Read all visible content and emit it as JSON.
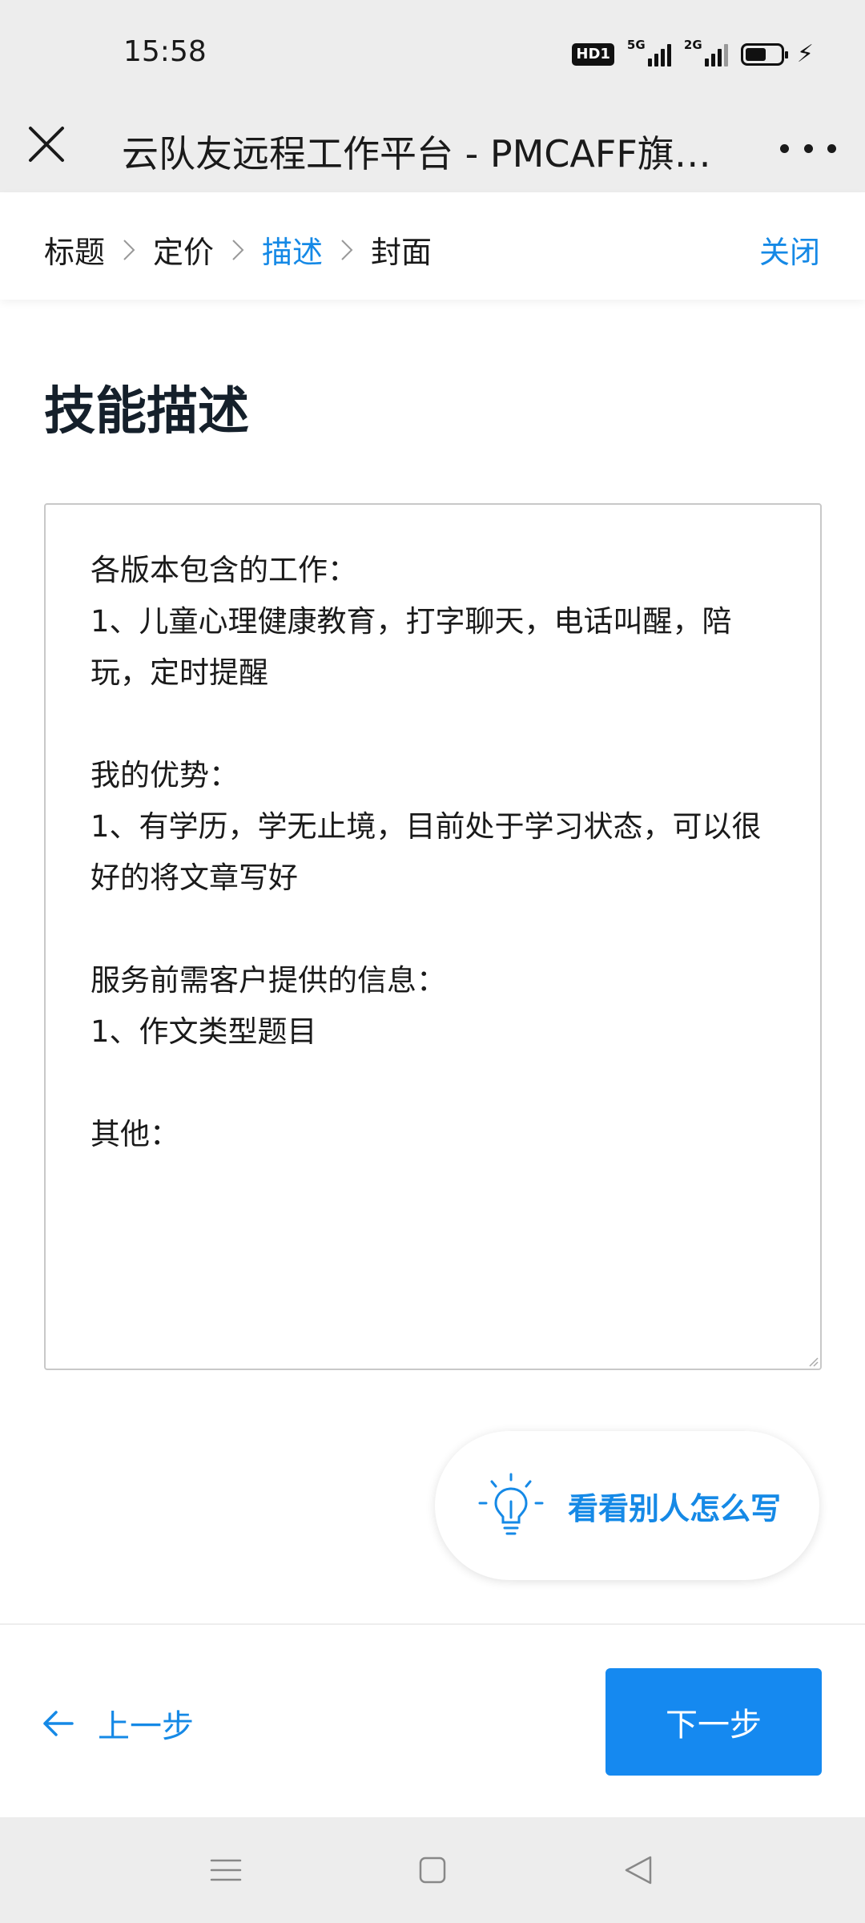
{
  "status_bar": {
    "time": "15:58",
    "hd_badge": "HD1",
    "signal_1_label": "5G",
    "signal_2_label": "2G",
    "battery_level": 0.6,
    "icons": [
      "hd-icon",
      "signal-5g-icon",
      "signal-2g-icon",
      "battery-icon",
      "charging-icon"
    ]
  },
  "title_bar": {
    "title": "云队友远程工作平台 - PMCAFF旗下…",
    "close_icon": "close-icon",
    "more_icon": "more-icon"
  },
  "steps_nav": {
    "steps": [
      {
        "label": "标题",
        "active": false
      },
      {
        "label": "定价",
        "active": false
      },
      {
        "label": "描述",
        "active": true
      },
      {
        "label": "封面",
        "active": false
      }
    ],
    "close_label": "关闭"
  },
  "page_title": "技能描述",
  "description": {
    "lines": [
      "各版本包含的工作：",
      "1、儿童心理健康教育，打字聊天，电话叫醒，陪",
      "玩，定时提醒",
      "",
      "我的优势：",
      "1、有学历，学无止境，目前处于学习状态，可以很",
      "好的将文章写好",
      "",
      "服务前需客户提供的信息：",
      "1、作文类型题目",
      "",
      "其他："
    ]
  },
  "hint_button": {
    "label": "看看别人怎么写",
    "icon": "lightbulb-icon"
  },
  "footer": {
    "prev_label": "上一步",
    "next_label": "下一步"
  },
  "colors": {
    "accent": "#1589e6",
    "next_button": "#1589f0",
    "system_bar": "#ededed"
  }
}
